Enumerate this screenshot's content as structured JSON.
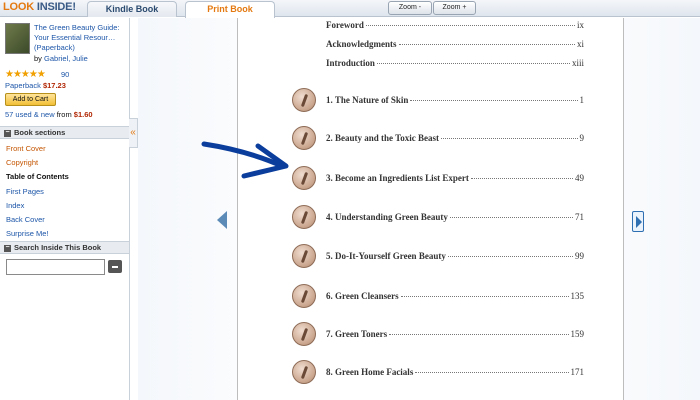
{
  "header": {
    "logo_look": "LOOK",
    "logo_inside": " INSIDE!",
    "tabs": [
      {
        "label": "Kindle Book"
      },
      {
        "label": "Print Book"
      }
    ],
    "zoom_minus": "Zoom -",
    "zoom_plus": "Zoom +"
  },
  "sidebar": {
    "book_title": "The Green Beauty Guide: Your Essential Resour… (Paperback)",
    "by": "by ",
    "author": "Gabriel, Julie",
    "stars": "★★★★★",
    "review_count": "90",
    "format": "Paperback",
    "price": "$17.23",
    "add_to_cart": "Add to Cart",
    "used_new": "57 used & new",
    "from": " from ",
    "used_price": "$1.60",
    "book_sections_header": "Book sections",
    "sections": [
      {
        "label": "Front Cover"
      },
      {
        "label": "Copyright"
      },
      {
        "label": "Table of Contents"
      },
      {
        "label": "First Pages"
      },
      {
        "label": "Index"
      },
      {
        "label": "Back Cover"
      },
      {
        "label": "Surprise Me!"
      }
    ],
    "search_header": "Search Inside This Book",
    "collapse_glyph": "«"
  },
  "toc": {
    "front_matter": [
      {
        "label": "Foreword",
        "page": "ix"
      },
      {
        "label": "Acknowledgments",
        "page": "xi"
      },
      {
        "label": "Introduction",
        "page": "xiii"
      }
    ],
    "chapters": [
      {
        "label": "1. The Nature of Skin",
        "page": "1",
        "icon": "skin-chapter-icon"
      },
      {
        "label": "2. Beauty and the Toxic Beast",
        "page": "9",
        "icon": "beast-chapter-icon"
      },
      {
        "label": "3. Become an Ingredients List Expert",
        "page": "49",
        "icon": "ingredients-chapter-icon"
      },
      {
        "label": "4. Understanding Green Beauty",
        "page": "71",
        "icon": "green-beauty-chapter-icon"
      },
      {
        "label": "5. Do-It-Yourself Green Beauty",
        "page": "99",
        "icon": "diy-chapter-icon"
      },
      {
        "label": "6. Green Cleansers",
        "page": "135",
        "icon": "cleansers-chapter-icon"
      },
      {
        "label": "7. Green Toners",
        "page": "159",
        "icon": "toners-chapter-icon"
      },
      {
        "label": "8. Green Home Facials",
        "page": "171",
        "icon": "facials-chapter-icon"
      }
    ]
  },
  "colors": {
    "accent_orange": "#e47911",
    "link_blue": "#1d56a8",
    "price_red": "#b12704",
    "annotation_arrow": "#0a3d9c"
  }
}
